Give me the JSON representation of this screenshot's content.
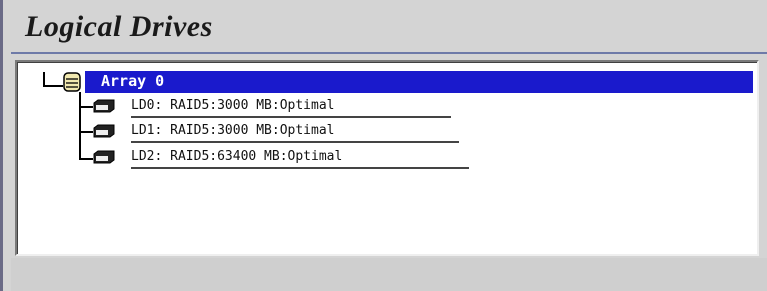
{
  "window": {
    "title": "Logical Drives"
  },
  "tree": {
    "array": {
      "label": "Array 0",
      "icon": "array-icon",
      "selected": true
    },
    "drives": [
      {
        "label": "LD0: RAID5:3000 MB:Optimal",
        "icon": "drive-icon"
      },
      {
        "label": "LD1: RAID5:3000 MB:Optimal",
        "icon": "drive-icon"
      },
      {
        "label": "LD2: RAID5:63400 MB:Optimal",
        "icon": "drive-icon"
      }
    ]
  },
  "colors": {
    "selection": "#1a1acc",
    "panel_background": "#ffffff",
    "window_background": "#d4d4d4"
  }
}
